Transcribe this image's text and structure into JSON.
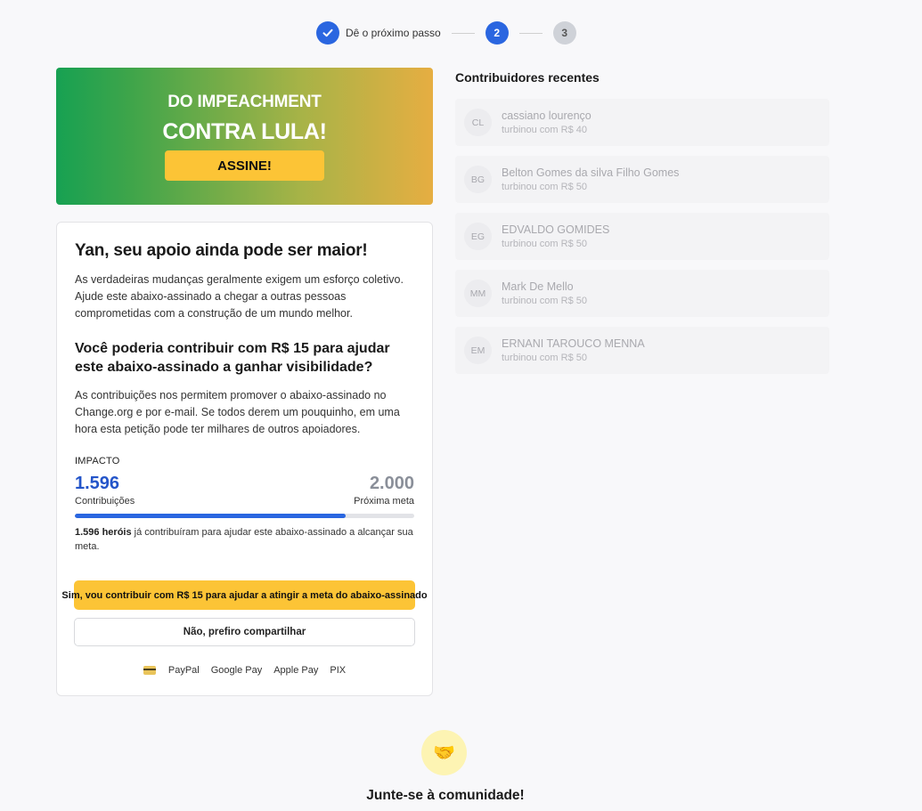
{
  "stepper": {
    "step1_label": "Dê o próximo passo",
    "step2_number": "2",
    "step3_number": "3",
    "current_step": 2
  },
  "banner": {
    "line1": "DO IMPEACHMENT",
    "line2": "CONTRA LULA!",
    "button_label": "ASSINE!"
  },
  "card": {
    "title": "Yan, seu apoio ainda pode ser maior!",
    "intro": "As verdadeiras mudanças geralmente exigem um esforço coletivo. Ajude este abaixo-assinado a chegar a outras pessoas comprometidas com a construção de um mundo melhor.",
    "question": "Você poderia contribuir com R$ 15 para ajudar este abaixo-assinado a ganhar visibilidade?",
    "explain": "As contribuições nos permitem promover o abaixo-assinado no Change.org e por e-mail. Se todos derem um pouquinho, em uma hora esta petição pode ter milhares de outros apoiadores.",
    "impact_label": "IMPACTO",
    "contributions_value": "1.596",
    "contributions_label": "Contribuições",
    "goal_value": "2.000",
    "goal_label": "Próxima meta",
    "progress_fraction": 0.798,
    "heroes_bold": "1.596 heróis",
    "heroes_rest": " já contribuíram para ajudar este abaixo-assinado a alcançar sua meta.",
    "yes_button": "Sim, vou contribuir com R$ 15 para ajudar a atingir a meta do abaixo-assinado",
    "no_button": "Não, prefiro compartilhar",
    "payment_methods": [
      "PayPal",
      "Google Pay",
      "Apple Pay",
      "PIX"
    ],
    "payment_icon": "credit-card-icon"
  },
  "contributors": {
    "title": "Contribuidores recentes",
    "items": [
      {
        "initials": "CL",
        "name": "cassiano lourenço",
        "amount": "turbinou com R$ 40"
      },
      {
        "initials": "BG",
        "name": "Belton Gomes da silva Filho Gomes",
        "amount": "turbinou com R$ 50"
      },
      {
        "initials": "EG",
        "name": "EDVALDO GOMIDES",
        "amount": "turbinou com R$ 50"
      },
      {
        "initials": "MM",
        "name": "Mark De Mello",
        "amount": "turbinou com R$ 50"
      },
      {
        "initials": "EM",
        "name": "ERNANI TAROUCO MENNA",
        "amount": "turbinou com R$ 50"
      }
    ]
  },
  "community": {
    "icon": "handshake-icon",
    "title": "Junte-se à comunidade!"
  },
  "colors": {
    "accent_blue": "#2a66e0",
    "yellow_button": "#fcc436",
    "banner_green": "#17a152",
    "banner_gold": "#e6ae42"
  }
}
